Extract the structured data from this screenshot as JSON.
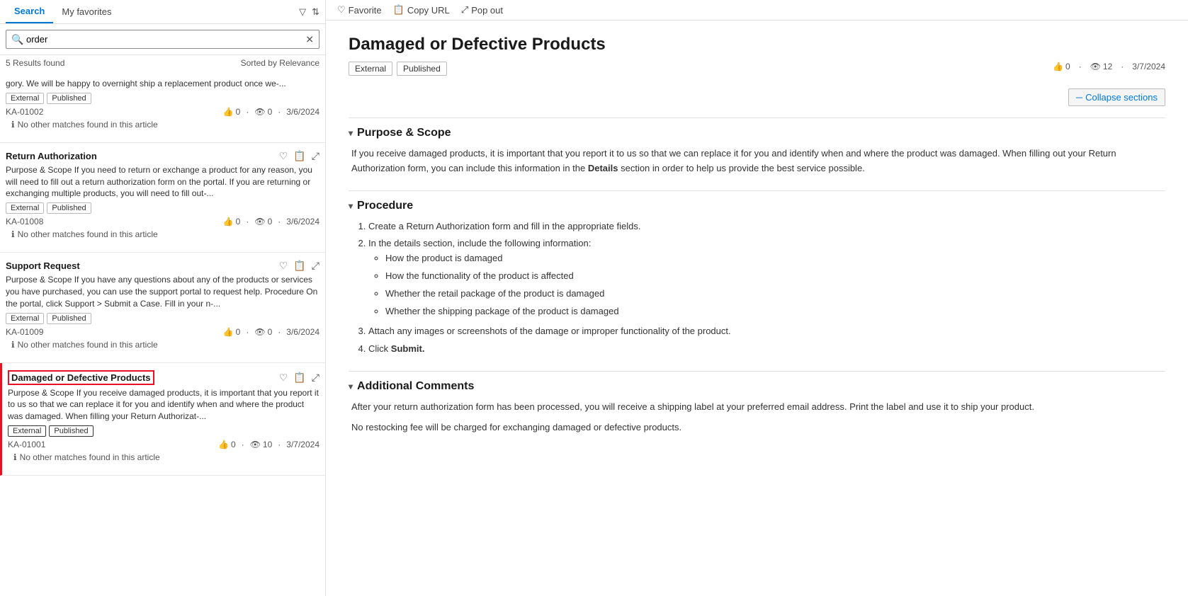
{
  "tabs": {
    "search_label": "Search",
    "favorites_label": "My favorites"
  },
  "tab_actions": {
    "filter_icon": "▼",
    "sort_icon": "⇅"
  },
  "search": {
    "value": "order",
    "placeholder": "Search"
  },
  "results_bar": {
    "count": "5 Results found",
    "sort": "Sorted by Relevance"
  },
  "results": [
    {
      "id": "r1",
      "title": null,
      "excerpt": "gory. We will be happy to overnight ship a replacement product once we-...",
      "tags": [
        "External",
        "Published"
      ],
      "ka": "KA-01002",
      "likes": "0",
      "views": "0",
      "date": "3/6/2024",
      "no_match": "No other matches found in this article",
      "selected": false
    },
    {
      "id": "r2",
      "title": "Return Authorization",
      "excerpt": "Purpose & Scope If you need to return or exchange a product for any reason, you will need to fill out a return authorization form on the portal. If you are returning or exchanging multiple products, you will need to fill out-...",
      "tags": [
        "External",
        "Published"
      ],
      "ka": "KA-01008",
      "likes": "0",
      "views": "0",
      "date": "3/6/2024",
      "no_match": "No other matches found in this article",
      "selected": false
    },
    {
      "id": "r3",
      "title": "Support Request",
      "excerpt": "Purpose & Scope If you have any questions about any of the products or services you have purchased, you can use the support portal to request help. Procedure On the portal, click Support > Submit a Case. Fill in your n-...",
      "tags": [
        "External",
        "Published"
      ],
      "ka": "KA-01009",
      "likes": "0",
      "views": "0",
      "date": "3/6/2024",
      "no_match": "No other matches found in this article",
      "selected": false
    },
    {
      "id": "r4",
      "title": "Damaged or Defective Products",
      "excerpt": "Purpose & Scope If you receive damaged products, it is important that you report it to us so that we can replace it for you and identify when and where the product was damaged. When filling your Return Authorizat-...",
      "tags": [
        "External",
        "Published"
      ],
      "ka": "KA-01001",
      "likes": "0",
      "views": "10",
      "date": "3/7/2024",
      "no_match": "No other matches found in this article",
      "selected": true
    }
  ],
  "toolbar": {
    "favorite_label": "Favorite",
    "copy_label": "Copy URL",
    "popout_label": "Pop out"
  },
  "article": {
    "title": "Damaged or Defective Products",
    "tags": [
      "External",
      "Published"
    ],
    "likes": "0",
    "views": "12",
    "date": "3/7/2024",
    "collapse_label": "Collapse sections",
    "sections": [
      {
        "id": "s1",
        "heading": "Purpose & Scope",
        "body_html": "purpose_scope"
      },
      {
        "id": "s2",
        "heading": "Procedure",
        "body_html": "procedure"
      },
      {
        "id": "s3",
        "heading": "Additional Comments",
        "body_html": "additional_comments"
      }
    ],
    "purpose_scope_text": "If you receive damaged products, it is important that you report it to us so that we can replace it for you and identify when and where the product was damaged. When filling out your Return Authorization form, you can include this information in the Details section in order to help us provide the best service possible.",
    "purpose_scope_bold": "Details",
    "procedure_intro": "1. Create a Return Authorization form and fill in the appropriate fields.",
    "procedure_step2": "2. In the details section, include the following information:",
    "procedure_bullets": [
      "How the product is damaged",
      "How the functionality of the product is affected",
      "Whether the retail package of the product is damaged",
      "Whether the shipping package of the product is damaged"
    ],
    "procedure_step3": "3. Attach any images or screenshots of the damage or improper functionality of the product.",
    "procedure_step4_prefix": "4. Click ",
    "procedure_step4_bold": "Submit.",
    "additional_line1": "After your return authorization form has been processed, you will receive a shipping label at your preferred email address. Print the label and use it to ship your product.",
    "additional_line2": "No restocking fee will be charged for exchanging damaged or defective products."
  }
}
